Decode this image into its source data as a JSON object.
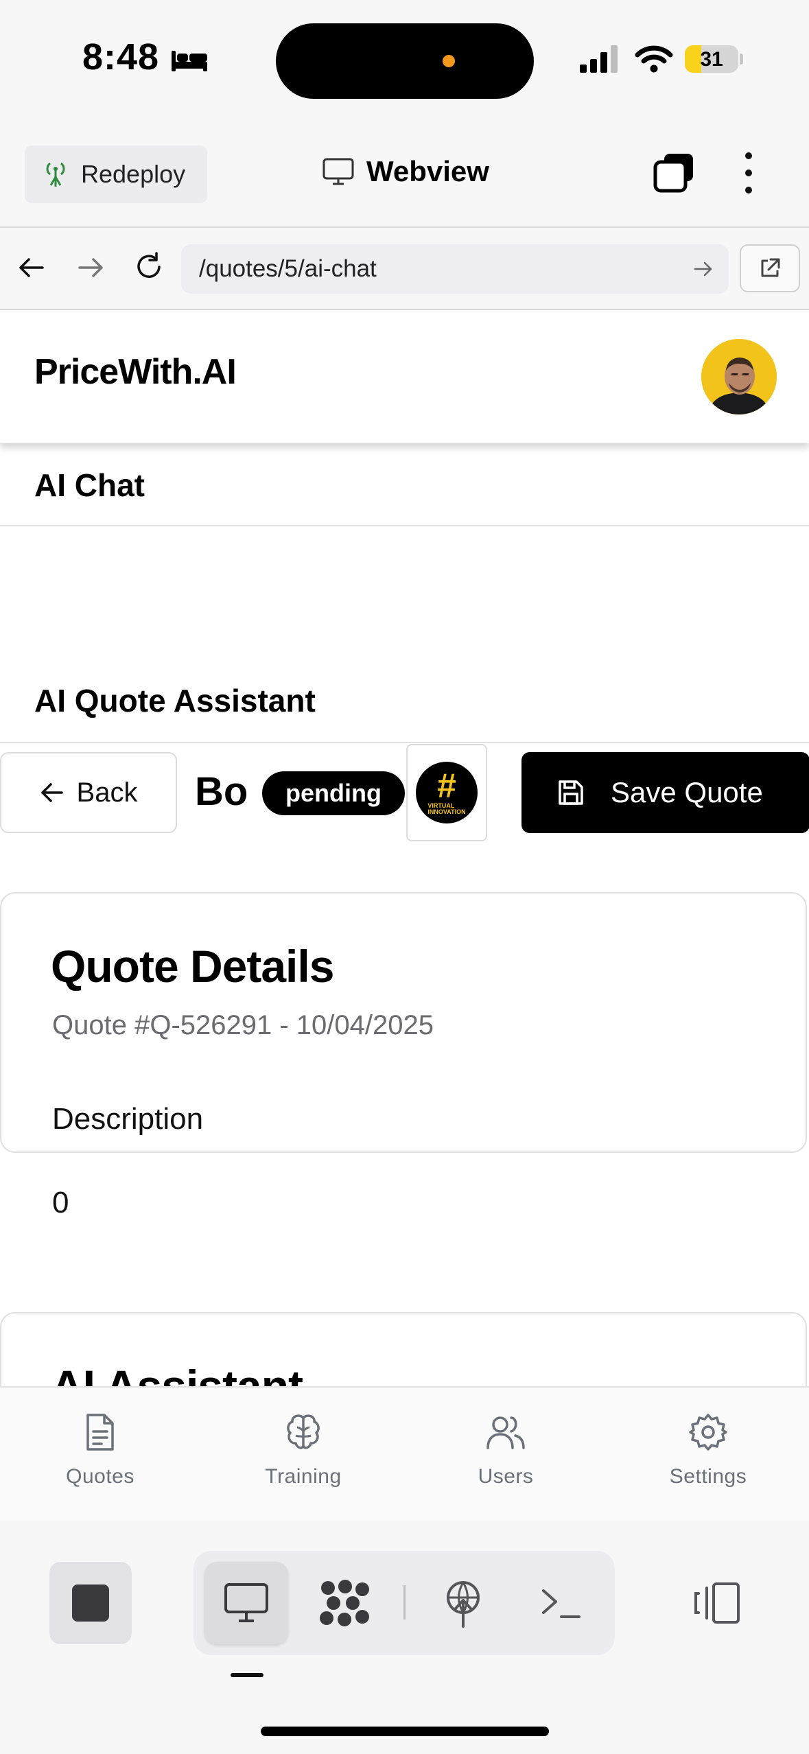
{
  "status_bar": {
    "time": "8:48",
    "battery": "31",
    "battery_level": 0.31
  },
  "toolbar": {
    "redeploy_label": "Redeploy",
    "title": "Webview"
  },
  "url_bar": {
    "url": "/quotes/5/ai-chat"
  },
  "app": {
    "brand": "PriceWith.AI",
    "section_title": "AI Chat",
    "assistant_title": "AI Quote Assistant",
    "back_label": "Back",
    "quote_name": "Bo",
    "status": "pending",
    "save_label": "Save Quote",
    "logo_text": "VIRTUAL INNOVATION"
  },
  "quote_card": {
    "title": "Quote Details",
    "subtitle": "Quote #Q-526291 - 10/04/2025",
    "description_label": "Description",
    "description_value": "0"
  },
  "assistant_card": {
    "title": "AI Assistant"
  },
  "bottom_nav": [
    {
      "label": "Quotes",
      "icon": "document-icon"
    },
    {
      "label": "Training",
      "icon": "brain-icon"
    },
    {
      "label": "Users",
      "icon": "users-icon"
    },
    {
      "label": "Settings",
      "icon": "gear-icon"
    }
  ],
  "colors": {
    "accent": "#000000",
    "brand_yellow": "#f2c31b",
    "battery_yellow": "#f8d21b"
  }
}
